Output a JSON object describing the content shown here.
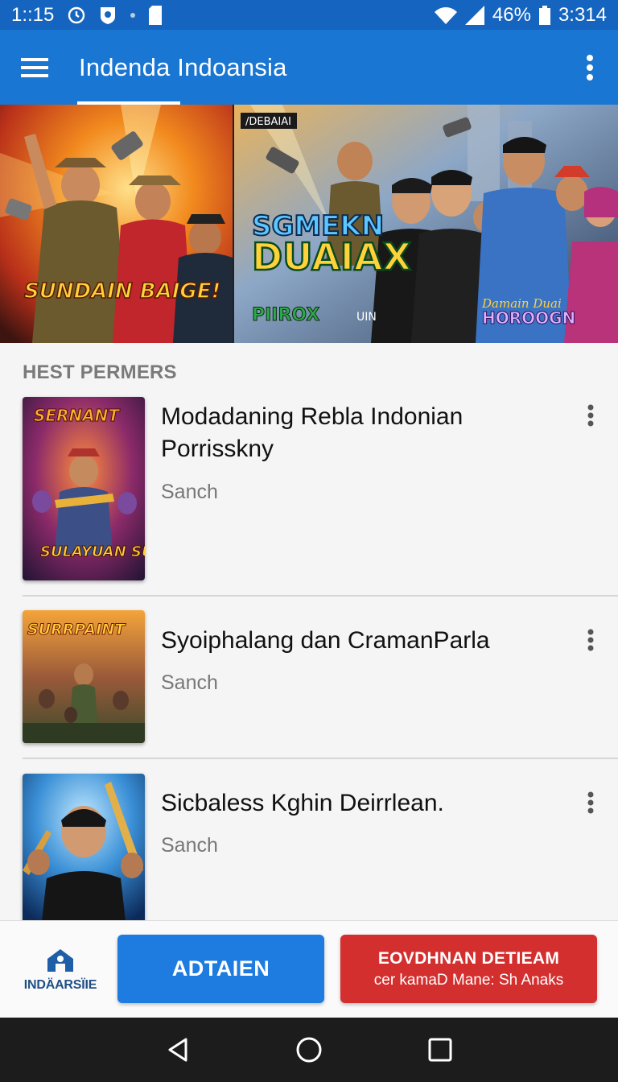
{
  "status_bar": {
    "time": "1::15",
    "battery": "46%",
    "clock_right": "3:314",
    "icons": [
      "alarm-icon",
      "shield-icon",
      "notification-dot-icon",
      "sim-icon",
      "wifi-icon",
      "signal-icon",
      "battery-icon"
    ]
  },
  "app_bar": {
    "title": "Indenda Indoansia",
    "menu_icon": "hamburger-icon",
    "overflow_icon": "more-vert-icon",
    "accent": "#1976d2"
  },
  "banner": {
    "left_title": "SUNDAIN BAIGE!",
    "right_tag": "/DEBAIAI",
    "right_title_line1": "SGMEKN",
    "right_title_line2": "DUAIAX",
    "right_logo_left": "PIIROX",
    "right_logo_mid": "UIN",
    "right_logo_right_top": "Damain Duai",
    "right_logo_right": "HOROOGN"
  },
  "section": {
    "title": "HEST PERMERS"
  },
  "list": [
    {
      "title": "Modadaning Rebla Indonian Porrissknу",
      "subtitle": "Sanch",
      "thumb_top": "SERNANT",
      "thumb_bottom": "SULAYUAN SUIN!"
    },
    {
      "title": "Syoiphalang dan CramanParla",
      "subtitle": "Sanch",
      "thumb_top": "SURRPAINT"
    },
    {
      "title": "Sicbaless Kghin Deirrlean.",
      "subtitle": "Sanch"
    }
  ],
  "action_bar": {
    "home_label": "INDÄARSÏIE",
    "primary_label": "ADTAIEN",
    "danger_line1": "EOVDHNAN DETIEAM",
    "danger_line2": "cer kamaD Mane: Sh Anaks",
    "primary_color": "#1e7be0",
    "danger_color": "#d32f2f"
  },
  "nav_bar": {
    "icons": [
      "back-icon",
      "home-circle-icon",
      "recents-icon"
    ]
  }
}
